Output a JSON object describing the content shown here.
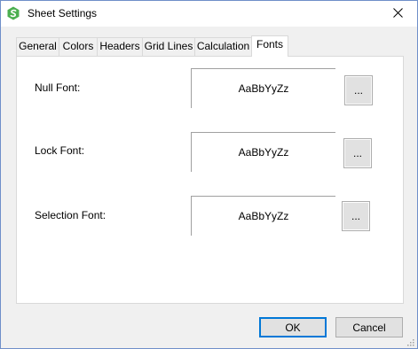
{
  "window": {
    "title": "Sheet Settings",
    "icon": "green-hexagon-s-logo",
    "accent_color": "#4caf50"
  },
  "tabs": [
    {
      "label": "General",
      "active": false
    },
    {
      "label": "Colors",
      "active": false
    },
    {
      "label": "Headers",
      "active": false
    },
    {
      "label": "Grid Lines",
      "active": false
    },
    {
      "label": "Calculation",
      "active": false
    },
    {
      "label": "Fonts",
      "active": true
    }
  ],
  "fonts": {
    "null_font": {
      "label": "Null Font:",
      "preview": "AaBbYyZz",
      "button": "..."
    },
    "lock_font": {
      "label": "Lock Font:",
      "preview": "AaBbYyZz",
      "button": "..."
    },
    "selection_font": {
      "label": "Selection Font:",
      "preview": "AaBbYyZz",
      "button": "..."
    }
  },
  "footer": {
    "ok_label": "OK",
    "cancel_label": "Cancel"
  }
}
